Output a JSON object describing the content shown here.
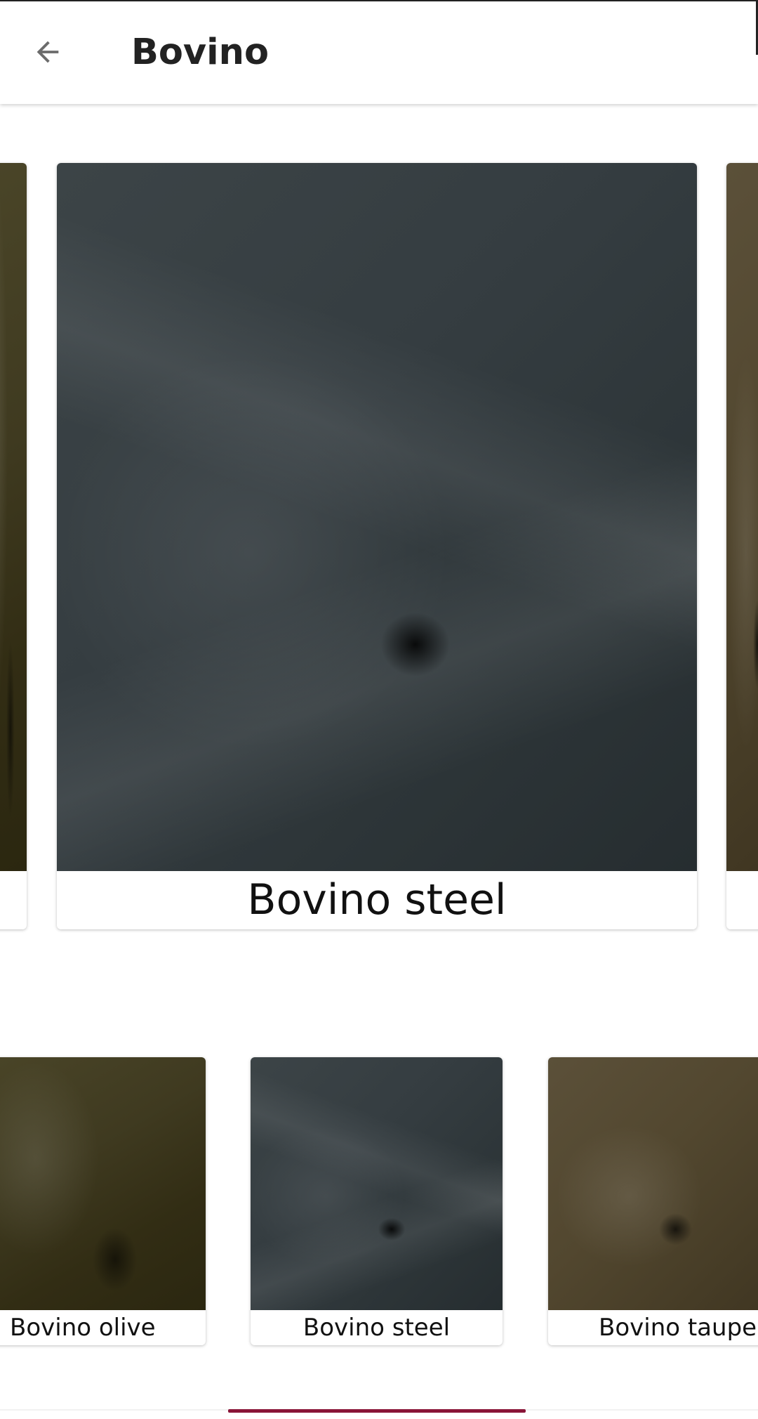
{
  "app_bar": {
    "title": "Bovino",
    "back_icon": "arrow-left-icon"
  },
  "carousel": {
    "selected_label": "Bovino steel"
  },
  "thumbnails": [
    {
      "label": "Bovino olive"
    },
    {
      "label": "Bovino steel"
    },
    {
      "label": "Bovino taupe"
    }
  ],
  "colors": {
    "indicator": "#8a1538",
    "olive": "#3f3a20",
    "steel": "#353d41",
    "taupe": "#52472f"
  }
}
